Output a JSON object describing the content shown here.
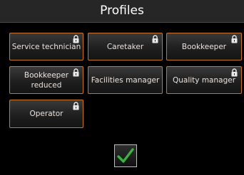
{
  "header": {
    "title": "Profiles"
  },
  "profiles": [
    {
      "label": "Service technician",
      "locked": true
    },
    {
      "label": "Caretaker",
      "locked": true
    },
    {
      "label": "Bookkeeper",
      "locked": true
    },
    {
      "label": "Bookkeeper reduced",
      "locked": true
    },
    {
      "label": "Facilities manager",
      "locked": false
    },
    {
      "label": "Quality manager",
      "locked": true
    },
    {
      "label": "Operator",
      "locked": true
    }
  ],
  "colors": {
    "accent_border": "#c8742a",
    "confirm_green": "#3cb043",
    "header_bg": "#262626"
  },
  "confirm": {
    "icon": "checkmark-icon"
  }
}
